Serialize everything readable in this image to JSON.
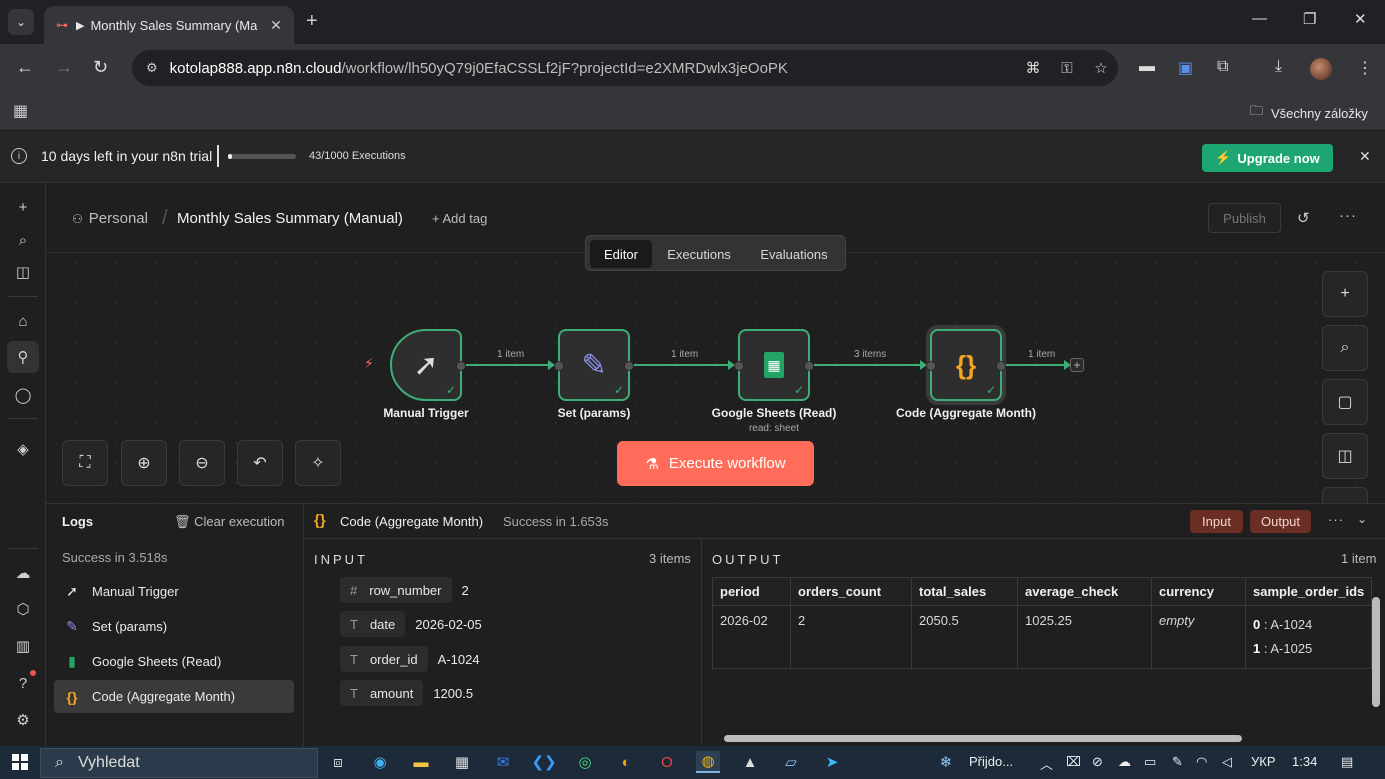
{
  "browser": {
    "tab_title": "Monthly Sales Summary (Ma",
    "url_host": "kotolap888.app.n8n.cloud",
    "url_rest": "/workflow/lh50yQ79j0EfaCSSLf2jF?projectId=e2XMRDwlx3jeOoPK",
    "bookmarks_all": "Všechny záložky"
  },
  "banner": {
    "text": "10 days left in your n8n trial",
    "executions": "43/1000 Executions",
    "progress": 0.043,
    "upgrade_label": "Upgrade now"
  },
  "header": {
    "project": "Personal",
    "workflow_title": "Monthly Sales Summary (Manual)",
    "add_tag": "+ Add tag",
    "publish": "Publish"
  },
  "view_tabs": [
    "Editor",
    "Executions",
    "Evaluations"
  ],
  "canvas": {
    "nodes": [
      {
        "label": "Manual Trigger",
        "sub": ""
      },
      {
        "label": "Set (params)",
        "sub": ""
      },
      {
        "label": "Google Sheets (Read)",
        "sub": "read: sheet"
      },
      {
        "label": "Code (Aggregate Month)",
        "sub": ""
      }
    ],
    "edges": [
      "1 item",
      "1 item",
      "3 items",
      "1 item"
    ],
    "execute_label": "Execute workflow"
  },
  "logs": {
    "title": "Logs",
    "clear": "Clear execution",
    "status": "Success in 3.518s",
    "items": [
      "Manual Trigger",
      "Set (params)",
      "Google Sheets (Read)",
      "Code (Aggregate Month)"
    ]
  },
  "detail": {
    "node_name": "Code (Aggregate Month)",
    "status": "Success in 1.653s",
    "input_btn": "Input",
    "output_btn": "Output",
    "input_label": "INPUT",
    "input_count": "3 items",
    "input_fields": [
      {
        "type": "#",
        "key": "row_number",
        "value": "2"
      },
      {
        "type": "T",
        "key": "date",
        "value": "2026-02-05"
      },
      {
        "type": "T",
        "key": "order_id",
        "value": "A-1024"
      },
      {
        "type": "T",
        "key": "amount",
        "value": "1200.5"
      }
    ],
    "output_label": "OUTPUT",
    "output_count": "1 item",
    "columns": [
      "period",
      "orders_count",
      "total_sales",
      "average_check",
      "currency",
      "sample_order_ids"
    ],
    "row": {
      "period": "2026-02",
      "orders_count": "2",
      "total_sales": "2050.5",
      "average_check": "1025.25",
      "currency": "empty",
      "sample_order_ids": [
        {
          "i": "0",
          "v": "A-1024"
        },
        {
          "i": "1",
          "v": "A-1025"
        }
      ]
    }
  },
  "taskbar": {
    "search": "Vyhledat",
    "weather": "Přijdo...",
    "lang": "УКР",
    "time": "1:34"
  }
}
